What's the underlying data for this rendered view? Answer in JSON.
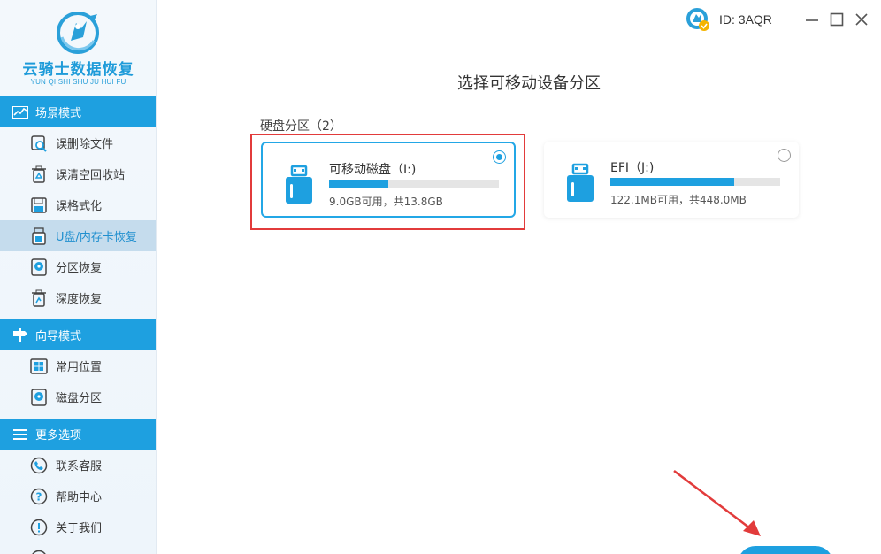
{
  "app": {
    "logo_title": "云骑士数据恢复",
    "logo_subtitle": "YUN QI SHI SHU JU HUI FU"
  },
  "account": {
    "id_text": "ID: 3AQR"
  },
  "window_controls": {
    "minimize": "minimize-icon",
    "maximize": "maximize-icon",
    "close": "close-icon"
  },
  "sidebar": {
    "sections": [
      {
        "title": "场景模式",
        "icon": "chart-icon",
        "items": [
          {
            "label": "误删除文件",
            "icon": "file-scan-icon",
            "active": false
          },
          {
            "label": "误清空回收站",
            "icon": "recycle-bin-icon",
            "active": false
          },
          {
            "label": "误格式化",
            "icon": "floppy-icon",
            "active": false
          },
          {
            "label": "U盘/内存卡恢复",
            "icon": "usb-drive-icon",
            "active": true
          },
          {
            "label": "分区恢复",
            "icon": "disk-icon",
            "active": false
          },
          {
            "label": "深度恢复",
            "icon": "trash-restore-icon",
            "active": false
          }
        ]
      },
      {
        "title": "向导模式",
        "icon": "signpost-icon",
        "items": [
          {
            "label": "常用位置",
            "icon": "windows-icon",
            "active": false
          },
          {
            "label": "磁盘分区",
            "icon": "disk-icon",
            "active": false
          }
        ]
      },
      {
        "title": "更多选项",
        "icon": "menu-icon",
        "items": [
          {
            "label": "联系客服",
            "icon": "phone-icon",
            "active": false
          },
          {
            "label": "帮助中心",
            "icon": "help-icon",
            "active": false
          },
          {
            "label": "关于我们",
            "icon": "info-icon",
            "active": false
          }
        ]
      }
    ]
  },
  "main": {
    "title": "选择可移动设备分区",
    "group_label": "硬盘分区（2）",
    "partitions": [
      {
        "name": "可移动磁盘（I:)",
        "capacity": "9.0GB可用，共13.8GB",
        "used_fraction": 0.35,
        "selected": true
      },
      {
        "name": "EFI（J:)",
        "capacity": "122.1MB可用，共448.0MB",
        "used_fraction": 0.73,
        "selected": false
      }
    ]
  },
  "colors": {
    "accent": "#1ea0e0",
    "highlight": "#e23b3b",
    "active_item_bg": "#c5dced"
  }
}
